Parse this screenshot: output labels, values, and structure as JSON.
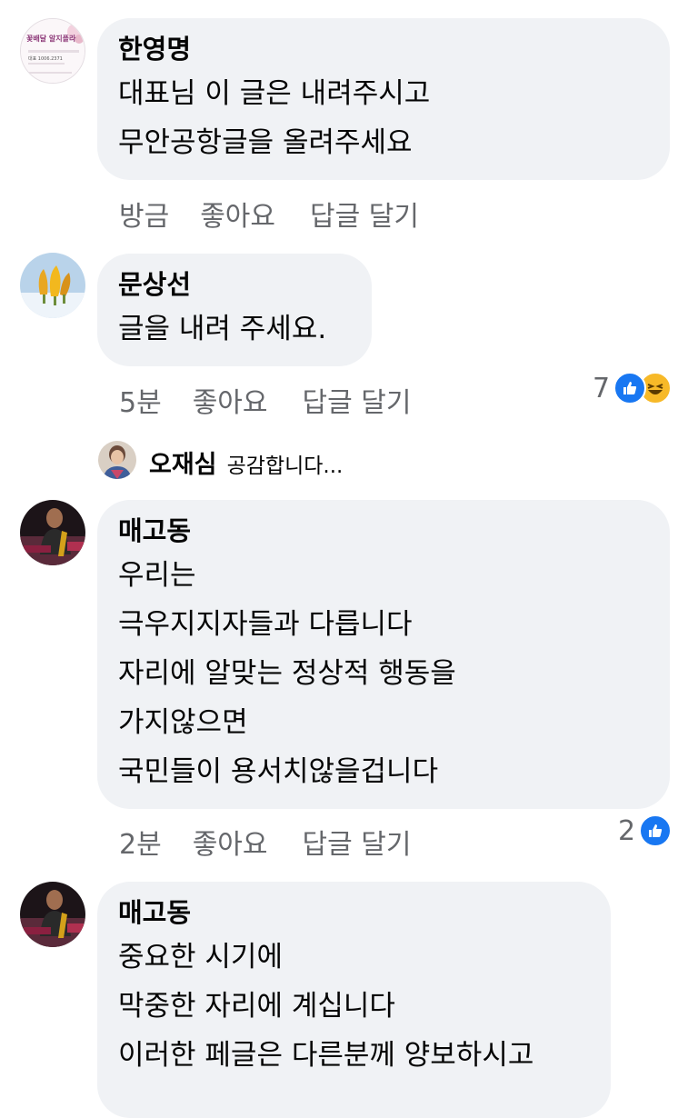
{
  "comments": [
    {
      "author": "한영명",
      "lines": [
        "대표님 이 글은  내려주시고",
        "무안공항글을 올려주세요"
      ],
      "avatar_text": [
        "꽃배달 알지플라",
        "대표 1006.2371"
      ],
      "time": "방금",
      "like": "좋아요",
      "reply": "답글 달기"
    },
    {
      "author": "문상선",
      "lines": [
        "글을 내려 주세요."
      ],
      "time": "5분",
      "like": "좋아요",
      "reply": "답글 달기",
      "reaction_count": "7",
      "reaction_icons": [
        "like-icon",
        "haha-icon"
      ]
    },
    {
      "author": "매고동",
      "lines": [
        "우리는",
        "극우지지자들과 다릅니다",
        "자리에 알맞는 정상적 행동을",
        "가지않으면",
        "국민들이 용서치않을겁니다"
      ],
      "time": "2분",
      "like": "좋아요",
      "reply": "답글 달기",
      "reaction_count": "2",
      "reaction_icons": [
        "like-icon"
      ]
    },
    {
      "author": "매고동",
      "lines": [
        "중요한 시기에",
        "막중한 자리에 계십니다",
        "이러한 페글은 다른분께 양보하시고"
      ]
    }
  ],
  "reply_preview": {
    "author": "오재심",
    "text": "공감합니다..."
  },
  "colors": {
    "bubble": "#f0f2f5",
    "secondary_text": "#65676b",
    "like_blue": "#1877f2",
    "haha_yellow": "#f7b928"
  }
}
